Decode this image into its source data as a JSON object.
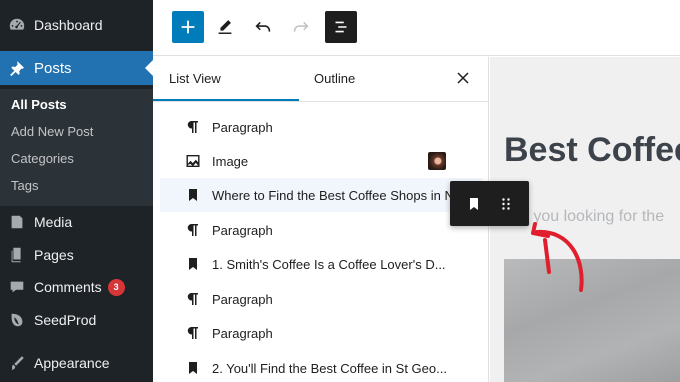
{
  "sidebar": {
    "items": [
      {
        "label": "Dashboard",
        "icon": "dashboard-icon"
      },
      {
        "label": "Posts",
        "icon": "pin-icon",
        "active": true
      },
      {
        "label": "Media",
        "icon": "media-icon"
      },
      {
        "label": "Pages",
        "icon": "pages-icon"
      },
      {
        "label": "Comments",
        "icon": "comments-icon",
        "badge": "3"
      },
      {
        "label": "SeedProd",
        "icon": "seedprod-icon"
      },
      {
        "label": "Appearance",
        "icon": "appearance-icon"
      }
    ],
    "posts_submenu": [
      "All Posts",
      "Add New Post",
      "Categories",
      "Tags"
    ]
  },
  "toolbar": {
    "buttons": [
      "add-block",
      "edit-tools",
      "undo",
      "redo",
      "document-overview"
    ]
  },
  "list_panel": {
    "tabs": [
      "List View",
      "Outline"
    ],
    "active_tab": "List View",
    "rows": [
      {
        "type": "paragraph",
        "label": "Paragraph"
      },
      {
        "type": "image",
        "label": "Image",
        "has_thumbnail": true
      },
      {
        "type": "heading-bookmark",
        "label": "Where to Find the Best Coffee Shops in NYC",
        "selected": true
      },
      {
        "type": "paragraph",
        "label": "Paragraph"
      },
      {
        "type": "heading-bookmark",
        "label": "1. Smith's Coffee Is a Coffee Lover's D..."
      },
      {
        "type": "paragraph",
        "label": "Paragraph"
      },
      {
        "type": "paragraph",
        "label": "Paragraph"
      },
      {
        "type": "heading-bookmark",
        "label": "2. You'll Find the Best Coffee in St Geo..."
      }
    ]
  },
  "canvas": {
    "title": "Best Coffee",
    "intro": "Are you looking for the"
  },
  "colors": {
    "sidebar_bg": "#1d2327",
    "accent": "#2271b1",
    "badge": "#d63638",
    "annotation_arrow": "#e01e2d"
  }
}
